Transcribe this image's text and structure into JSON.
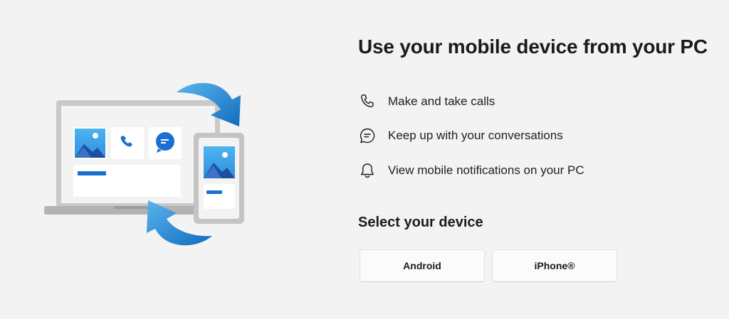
{
  "title": "Use your mobile device from your PC",
  "features": [
    {
      "icon": "phone-icon",
      "label": "Make and take calls"
    },
    {
      "icon": "chat-icon",
      "label": "Keep up with your conversations"
    },
    {
      "icon": "bell-icon",
      "label": "View mobile notifications on your PC"
    }
  ],
  "device_section": {
    "heading": "Select your device",
    "buttons": [
      {
        "label": "Android"
      },
      {
        "label": "iPhone®"
      }
    ]
  },
  "colors": {
    "background": "#f3f3f3",
    "accent": "#0078d4",
    "arrow": "#2a8fd8"
  }
}
